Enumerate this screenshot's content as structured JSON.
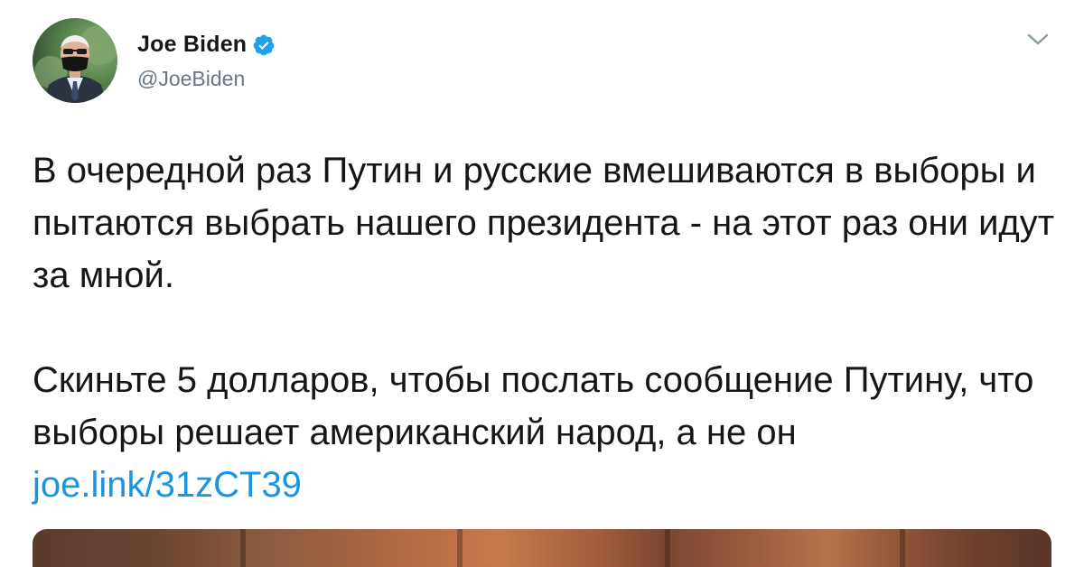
{
  "author": {
    "display_name": "Joe Biden",
    "handle": "@JoeBiden",
    "verified": true,
    "avatar_icon": "avatar-photo"
  },
  "menu": {
    "icon": "chevron-down-icon"
  },
  "tweet": {
    "paragraph1": "В очередной раз Путин и русские вмешиваются в выборы и пытаются выбрать нашего президента - на этот раз они идут за мной.",
    "paragraph2_text": "Скиньте 5 долларов, чтобы послать сообщение Путину, что выборы решает американский народ, а не он ",
    "link": "joe.link/31zCT39"
  },
  "colors": {
    "text": "#14171a",
    "secondary": "#657786",
    "link": "#1b95e0",
    "verified": "#1da1f2"
  }
}
